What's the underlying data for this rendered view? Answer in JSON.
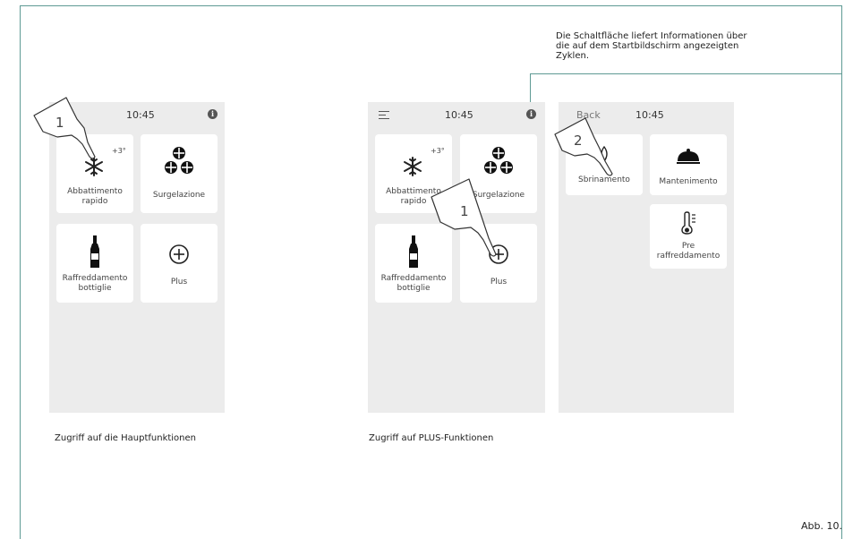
{
  "note": {
    "line1": "Die Schaltfläche liefert Informationen über",
    "line2": "die auf dem Startbildschirm angezeigten",
    "line3": "Zyklen."
  },
  "screen1": {
    "time": "10:45",
    "tiles": [
      {
        "label1": "Abbattimento",
        "label2": "rapido",
        "temp": "+3°",
        "icon": "snowflake-icon"
      },
      {
        "label1": "Surgelazione",
        "label2": "",
        "icon": "triple-snowflake-icon"
      },
      {
        "label1": "Raffreddamento",
        "label2": "bottiglie",
        "icon": "bottle-icon"
      },
      {
        "label1": "Plus",
        "label2": "",
        "icon": "plus-circle-icon"
      }
    ],
    "step": "1",
    "caption": "Zugriff auf die Hauptfunktionen"
  },
  "screen2": {
    "time": "10:45",
    "tiles": [
      {
        "label1": "Abbattimento",
        "label2": "rapido",
        "temp": "+3°",
        "icon": "snowflake-icon"
      },
      {
        "label1": "Surgelazione",
        "label2": "",
        "icon": "triple-snowflake-icon"
      },
      {
        "label1": "Raffreddamento",
        "label2": "bottiglie",
        "icon": "bottle-icon"
      },
      {
        "label1": "Plus",
        "label2": "",
        "icon": "plus-circle-icon"
      }
    ],
    "step": "1",
    "caption": "Zugriff auf PLUS-Funktionen"
  },
  "screen3": {
    "back": "Back",
    "time": "10:45",
    "tiles": [
      {
        "label1": "Sbrinamento",
        "label2": "",
        "icon": "defrost-icon"
      },
      {
        "label1": "Mantenimento",
        "label2": "",
        "icon": "cloche-icon"
      },
      {
        "label1": "Pre",
        "label2": "raffreddamento",
        "icon": "thermometer-icon"
      }
    ],
    "step": "2"
  },
  "figure_ref": "Abb. 10.",
  "colors": {
    "frame": "#5e9a94",
    "screen_bg": "#ececec",
    "tile_bg": "#ffffff"
  }
}
